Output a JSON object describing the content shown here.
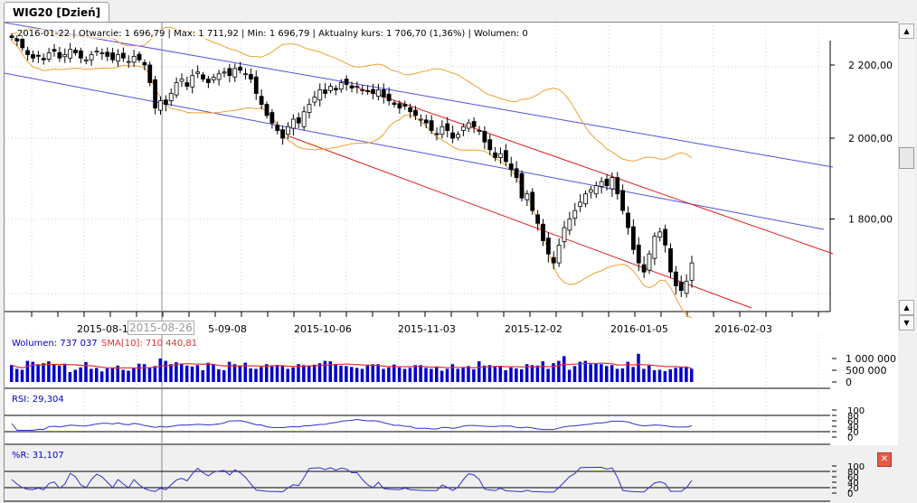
{
  "tab": {
    "label": "WIG20 [Dzień]"
  },
  "info": "2016-01-22 | Otwarcie: 1 696,79 | Max: 1 711,92 | Min: 1 696,79 | Aktualny kurs: 1 706,70 (1,36%)  | Wolumen: 0",
  "volume_label": "Wolumen: 737 037",
  "sma_label": "SMA[10]: 710 440,81",
  "rsi_label": "RSI: 29,304",
  "wr_label": "%R: 31,107",
  "cursor_date": "2015-08-26",
  "colors": {
    "up": "#ffffff",
    "down": "#000000",
    "volume": "#0000cc",
    "sma": "#dd3333",
    "bands": "#f0a030",
    "channel_blue": "#5050e0",
    "channel_red": "#e02020",
    "osc": "#3030d0"
  },
  "chart_data": {
    "type": "candlestick",
    "price_ticks": [
      "2 200,00",
      "2 000,00",
      "1 800,00"
    ],
    "price_tick_values": [
      2200,
      2000,
      1800
    ],
    "date_ticks": [
      "2015-08-1",
      "5-09-08",
      "2015-10-06",
      "2015-11-03",
      "2015-12-02",
      "2016-01-05",
      "2016-02-03"
    ],
    "volume_ticks": [
      "1 000 000",
      "500 000",
      "0"
    ],
    "rsi_ticks": [
      "100",
      "80",
      "60",
      "40",
      "20",
      "0"
    ],
    "wr_ticks": [
      "100",
      "80",
      "60",
      "40",
      "20",
      "0"
    ],
    "closes": [
      2280,
      2270,
      2250,
      2230,
      2220,
      2225,
      2215,
      2235,
      2240,
      2220,
      2230,
      2245,
      2235,
      2220,
      2215,
      2230,
      2240,
      2235,
      2225,
      2215,
      2230,
      2220,
      2210,
      2225,
      2215,
      2200,
      2150,
      2080,
      2100,
      2090,
      2120,
      2150,
      2160,
      2140,
      2170,
      2180,
      2160,
      2150,
      2165,
      2175,
      2180,
      2170,
      2190,
      2185,
      2175,
      2160,
      2120,
      2090,
      2060,
      2040,
      2020,
      2000,
      2030,
      2050,
      2040,
      2070,
      2090,
      2110,
      2130,
      2120,
      2140,
      2130,
      2150,
      2145,
      2135,
      2140,
      2130,
      2125,
      2120,
      2130,
      2110,
      2100,
      2090,
      2080,
      2085,
      2070,
      2060,
      2050,
      2040,
      2020,
      2010,
      2030,
      2020,
      2000,
      2010,
      2030,
      2040,
      2030,
      2020,
      1990,
      1970,
      1950,
      1960,
      1940,
      1920,
      1900,
      1850,
      1860,
      1820,
      1790,
      1750,
      1720,
      1700,
      1740,
      1780,
      1800,
      1820,
      1840,
      1860,
      1870,
      1880,
      1890,
      1880,
      1900,
      1860,
      1820,
      1780,
      1730,
      1700,
      1680,
      1720,
      1760,
      1770,
      1740,
      1680,
      1650,
      1640,
      1660,
      1700
    ],
    "volume_k": [
      720,
      560,
      520,
      900,
      860,
      760,
      800,
      880,
      740,
      700,
      780,
      420,
      520,
      620,
      850,
      560,
      600,
      450,
      580,
      620,
      700,
      520,
      480,
      600,
      780,
      760,
      620,
      680,
      1000,
      900,
      760,
      840,
      780,
      700,
      660,
      720,
      500,
      820,
      760,
      540,
      500,
      860,
      760,
      700,
      820,
      580,
      560,
      640,
      760,
      700,
      720,
      680,
      560,
      620,
      760,
      720,
      700,
      740,
      800,
      900,
      880,
      760,
      700,
      680,
      640,
      600,
      560,
      700,
      760,
      760,
      560,
      620,
      740,
      620,
      560,
      600,
      720,
      720,
      600,
      560,
      660,
      480,
      560,
      760,
      560,
      600,
      680,
      540,
      880,
      700,
      720,
      640,
      660,
      500,
      620,
      580,
      540,
      760,
      720,
      700,
      880,
      560,
      800,
      900,
      1100,
      520,
      680,
      860,
      900,
      760,
      780,
      760,
      680,
      720,
      560,
      580,
      860,
      640,
      1200,
      560,
      700,
      500,
      520,
      460,
      540,
      600,
      620,
      660,
      560
    ],
    "sma_value": 710440.81
  }
}
